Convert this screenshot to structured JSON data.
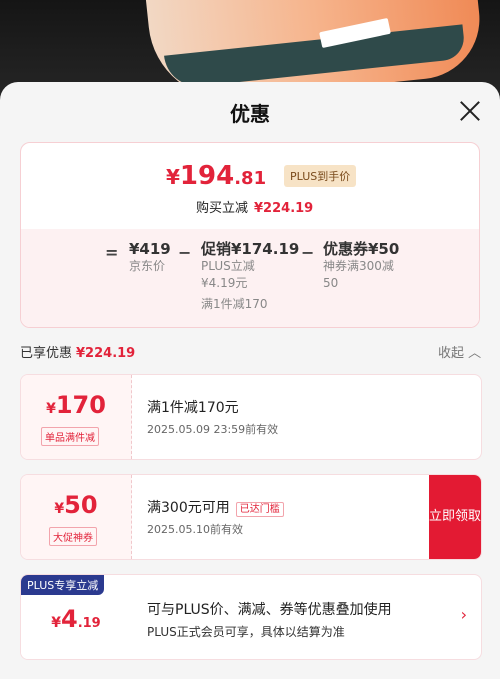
{
  "sheet": {
    "title": "优惠"
  },
  "summary": {
    "final_currency": "¥",
    "final_int": "194",
    "final_dec": ".81",
    "plus_tag": "PLUS到手价",
    "buy_label": "购买立减",
    "buy_amount": "¥224.19",
    "eq": "=",
    "minus": "−",
    "base_price": "¥419",
    "base_label": "京东价",
    "promo_price": "促销¥174.19",
    "promo_sub1": "PLUS立减",
    "promo_sub2": "¥4.19元",
    "promo_sub3": "满1件减170",
    "coupon_price": "优惠券¥50",
    "coupon_sub1": "神券满300减",
    "coupon_sub2": "50"
  },
  "enjoyed": {
    "label": "已享优惠",
    "amount": "¥224.19",
    "collapse": "收起 ︿"
  },
  "cards": [
    {
      "currency": "¥",
      "num": "170",
      "dec": "",
      "tag": "单品满件减",
      "title": "满1件减170元",
      "badge": "",
      "subtitle": "2025.05.09 23:59前有效"
    },
    {
      "currency": "¥",
      "num": "50",
      "dec": "",
      "tag": "大促神券",
      "title": "满300元可用",
      "badge": "已达门槛",
      "subtitle": "2025.05.10前有效",
      "button": "立即领取"
    },
    {
      "currency": "¥",
      "num": "4",
      "dec": ".19",
      "ribbon": "PLUS专享立减",
      "title": "可与PLUS价、满减、券等优惠叠加使用",
      "subtitle": "PLUS正式会员可享，具体以结算为准",
      "chevron": "›"
    }
  ],
  "colors": {
    "accent": "#e2233a",
    "plus_blue": "#2b3a8f",
    "button": "#e31a33"
  }
}
